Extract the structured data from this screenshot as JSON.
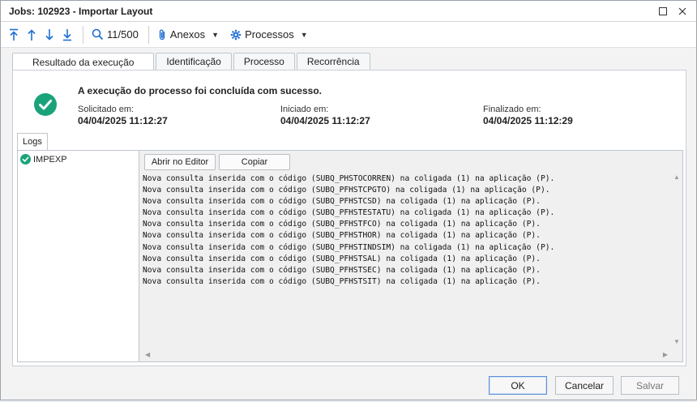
{
  "window": {
    "title": "Jobs: 102923 - Importar Layout"
  },
  "toolbar": {
    "record_counter": "11/500",
    "attachments_label": "Anexos",
    "processes_label": "Processos"
  },
  "tabs": [
    {
      "label": "Resultado da execução"
    },
    {
      "label": "Identificação"
    },
    {
      "label": "Processo"
    },
    {
      "label": "Recorrência"
    }
  ],
  "result": {
    "message": "A execução do processo foi concluída com sucesso.",
    "requested_label": "Solicitado em:",
    "requested_value": "04/04/2025 11:12:27",
    "started_label": "Iniciado em:",
    "started_value": "04/04/2025 11:12:27",
    "finished_label": "Finalizado em:",
    "finished_value": "04/04/2025 11:12:29"
  },
  "logs": {
    "tab_label": "Logs",
    "items": [
      {
        "label": "IMPEXP"
      }
    ],
    "open_editor_label": "Abrir no Editor",
    "copy_label": "Copiar",
    "lines": [
      "Nova consulta inserida com o código (SUBQ_PHSTOCORREN) na coligada (1) na aplicação (P).",
      "Nova consulta inserida com o código (SUBQ_PFHSTCPGTO) na coligada (1) na aplicação (P).",
      "Nova consulta inserida com o código (SUBQ_PFHSTCSD) na coligada (1) na aplicação (P).",
      "Nova consulta inserida com o código (SUBQ_PFHSTESTATU) na coligada (1) na aplicação (P).",
      "Nova consulta inserida com o código (SUBQ_PFHSTFCO) na coligada (1) na aplicação (P).",
      "Nova consulta inserida com o código (SUBQ_PFHSTHOR) na coligada (1) na aplicação (P).",
      "Nova consulta inserida com o código (SUBQ_PFHSTINDSIM) na coligada (1) na aplicação (P).",
      "Nova consulta inserida com o código (SUBQ_PFHSTSAL) na coligada (1) na aplicação (P).",
      "Nova consulta inserida com o código (SUBQ_PFHSTSEC) na coligada (1) na aplicação (P).",
      "Nova consulta inserida com o código (SUBQ_PFHSTSIT) na coligada (1) na aplicação (P)."
    ]
  },
  "footer": {
    "ok_label": "OK",
    "cancel_label": "Cancelar",
    "save_label": "Salvar"
  },
  "colors": {
    "accent": "#1f6fd1",
    "success": "#1aa37a"
  }
}
